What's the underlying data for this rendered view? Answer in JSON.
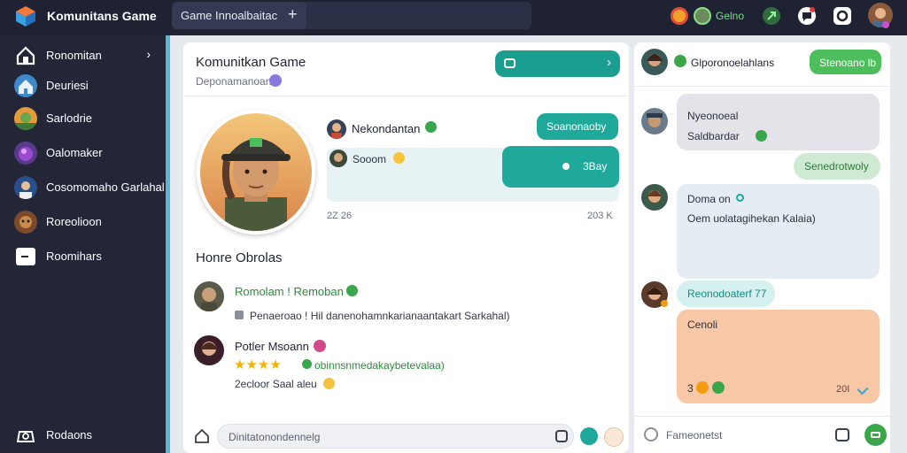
{
  "app": {
    "title": "Komunitans Game"
  },
  "tab": {
    "label": "Game Innoalbaitac"
  },
  "topbar": {
    "status_text": "Gelno"
  },
  "sidebar": {
    "items": [
      {
        "label": "Ronomitan"
      },
      {
        "label": "Deuriesi"
      },
      {
        "label": "Sarlodrie"
      },
      {
        "label": "Oalomaker"
      },
      {
        "label": "Cosomomaho Garlahal"
      },
      {
        "label": "Roreolioon"
      },
      {
        "label": "Roomihars"
      }
    ],
    "footer_label": "Rodaons"
  },
  "main": {
    "title": "Komunitkan Game",
    "subtitle": "Deponamanoan",
    "chat": {
      "name": "Nekondantan",
      "sent_pill": "Soanonaoby",
      "msg": "Sooom",
      "teal_block_text": "3Bay",
      "time_left": "2Z 26",
      "time_right": "203 K"
    },
    "section_title": "Honre Obrolas",
    "posts": [
      {
        "author": "Romolam ! Remoban",
        "text": "Penaeroao ! Hil danenohamnkarianaantakart Sarkahal)"
      },
      {
        "author": "Potler Msoann",
        "text": "obinnsnmedakaybetevalaa)",
        "footer": "2ecloor Saal aleu"
      }
    ],
    "composer_placeholder": "Dinitatonondennelg"
  },
  "right_panel": {
    "header": "Glporonoelahlans",
    "button_label": "Stenoano lb",
    "messages": [
      {
        "line1": "Nyeonoeal",
        "line2": "Saldbardar"
      },
      {
        "text": "Senedrotwoly"
      },
      {
        "line1": "Doma on",
        "line2": "Oem uolatagihekan Kalaia)"
      },
      {
        "text": "Reonodoaterf 77"
      },
      {
        "line1": "Cenoli",
        "footer_left": "3",
        "footer_right": "20I"
      }
    ],
    "composer_placeholder": "Fameonetst"
  },
  "colors": {
    "teal": "#1fa99a",
    "green": "#4cbf5c",
    "sidebar": "#222637",
    "accent": "#5ab8d6",
    "peach": "#f7c7a6"
  }
}
